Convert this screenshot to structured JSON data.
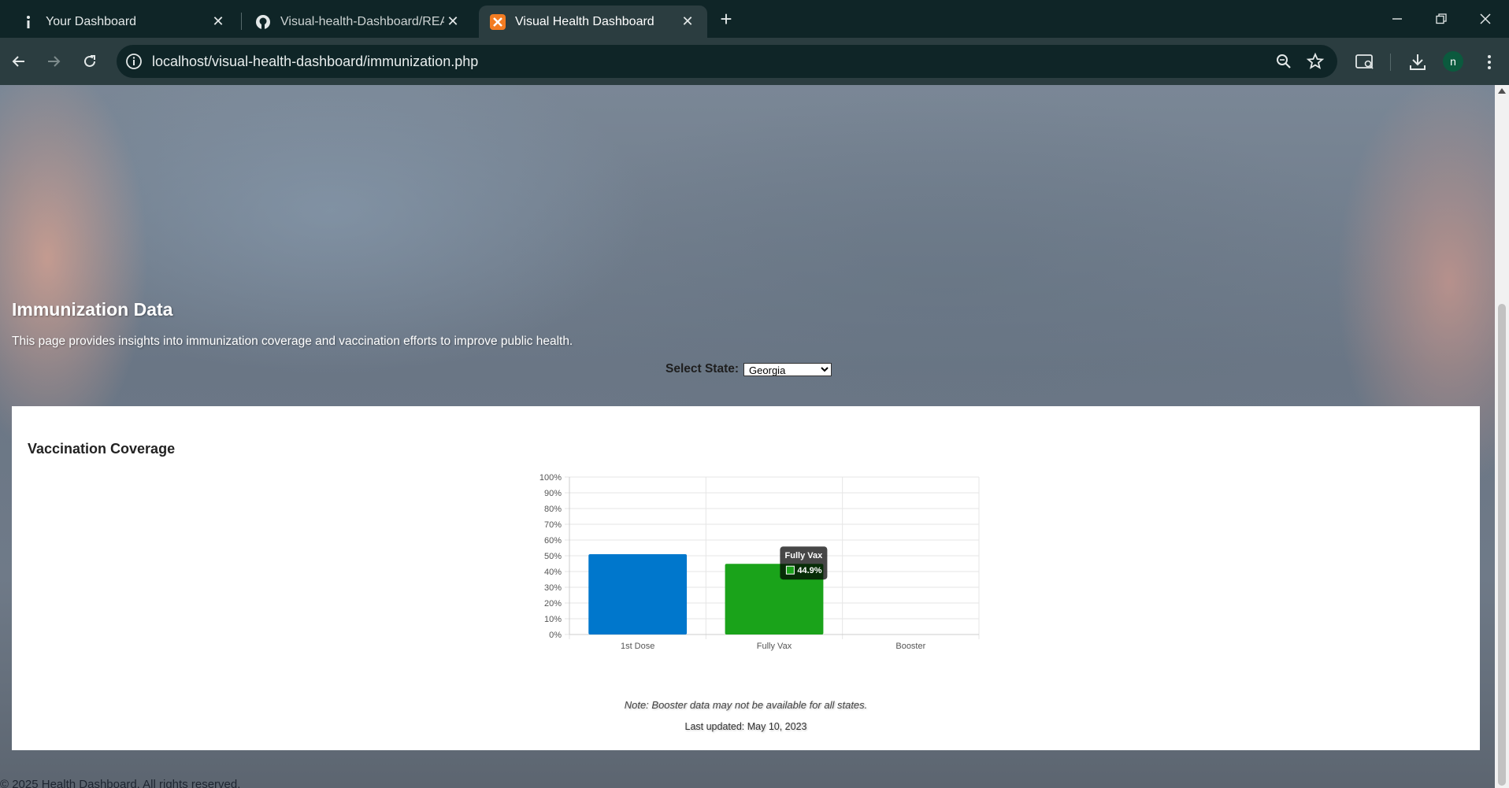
{
  "browser": {
    "tabs": [
      {
        "title": "Your Dashboard",
        "icon": "info-icon"
      },
      {
        "title": "Visual-health-Dashboard/README",
        "icon": "github-icon"
      },
      {
        "title": "Visual Health Dashboard",
        "icon": "xampp-icon",
        "active": true
      }
    ],
    "url": "localhost/visual-health-dashboard/immunization.php",
    "profile_initial": "n"
  },
  "page": {
    "title": "Immunization Data",
    "description": "This page provides insights into immunization coverage and vaccination efforts to improve public health.",
    "state_label": "Select State:",
    "selected_state": "Georgia",
    "card_title": "Vaccination Coverage",
    "note": "Note: Booster data may not be available for all states.",
    "last_updated": "Last updated: May 10, 2023",
    "footer": "© 2025 Health Dashboard. All rights reserved."
  },
  "chart_data": {
    "type": "bar",
    "categories": [
      "1st Dose",
      "Fully Vax",
      "Booster"
    ],
    "values": [
      51,
      44.9,
      0
    ],
    "colors": [
      "#0077cc",
      "#1aa31a",
      "#888888"
    ],
    "ylim": [
      0,
      100
    ],
    "yticks": [
      "0%",
      "10%",
      "20%",
      "30%",
      "40%",
      "50%",
      "60%",
      "70%",
      "80%",
      "90%",
      "100%"
    ],
    "grid": true,
    "tooltip": {
      "category": "Fully Vax",
      "value": "44.9%"
    }
  }
}
